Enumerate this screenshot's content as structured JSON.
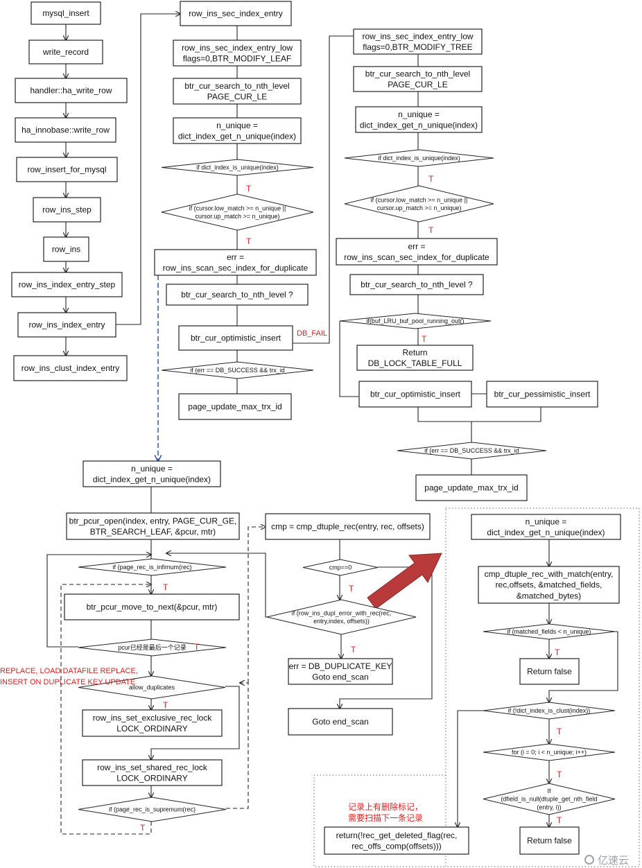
{
  "nodes": {
    "mysql_insert": [
      "mysql_insert"
    ],
    "write_record": [
      "write_record"
    ],
    "ha_write_row": [
      "handler::ha_write_row"
    ],
    "innobase_write_row": [
      "ha_innobase::write_row"
    ],
    "row_insert_for_mysql": [
      "row_insert_for_mysql"
    ],
    "row_ins_step": [
      "row_ins_step"
    ],
    "row_ins": [
      "row_ins"
    ],
    "row_ins_index_entry_step": [
      "row_ins_index_entry_step"
    ],
    "row_ins_index_entry": [
      "row_ins_index_entry"
    ],
    "row_ins_clust_index_entry": [
      "row_ins_clust_index_entry"
    ],
    "sec_index_entry": [
      "row_ins_sec_index_entry"
    ],
    "sec_low_leaf": [
      "row_ins_sec_index_entry_low",
      "flags=0,BTR_MODIFY_LEAF"
    ],
    "search_le_1": [
      "btr_cur_search_to_nth_level",
      "PAGE_CUR_LE"
    ],
    "n_unique_1": [
      "n_unique =",
      "dict_index_get_n_unique(index)"
    ],
    "is_unique_1": [
      "if dict_index_is_unique(index)"
    ],
    "cursor_match_1": [
      "if (cursor.low_match >= n_unique ||",
      "cursor.up_match >= n_unique)"
    ],
    "scan_dup_1": [
      "err =",
      "row_ins_scan_sec_index_for_duplicate"
    ],
    "search_q_1": [
      "btr_cur_search_to_nth_level ?"
    ],
    "opt_insert_1": [
      "btr_cur_optimistic_insert"
    ],
    "err_success_1": [
      "if (err == DB_SUCCESS && trx_id"
    ],
    "max_trx_1": [
      "page_update_max_trx_id"
    ],
    "sec_low_tree": [
      "row_ins_sec_index_entry_low",
      "flags=0,BTR_MODIFY_TREE"
    ],
    "search_le_2": [
      "btr_cur_search_to_nth_level",
      "PAGE_CUR_LE"
    ],
    "n_unique_2": [
      "n_unique =",
      "dict_index_get_n_unique(index)"
    ],
    "is_unique_2": [
      "if dict_index_is_unique(index)"
    ],
    "cursor_match_2": [
      "if (cursor.low_match >= n_unique ||",
      "cursor.up_match >= n_unique)"
    ],
    "scan_dup_2": [
      "err =",
      "row_ins_scan_sec_index_for_duplicate"
    ],
    "search_q_2": [
      "btr_cur_search_to_nth_level ?"
    ],
    "pool_running_out": [
      "if(buf_LRU_buf_pool_running_out()"
    ],
    "lock_table_full": [
      "Return",
      "DB_LOCK_TABLE_FULL"
    ],
    "opt_insert_2": [
      "btr_cur_optimistic_insert"
    ],
    "pess_insert": [
      "btr_cur_pessimistic_insert"
    ],
    "err_success_2": [
      "if (err == DB_SUCCESS && trx_id"
    ],
    "max_trx_2": [
      "page_update_max_trx_id"
    ],
    "n_unique_3": [
      "n_unique =",
      "dict_index_get_n_unique(index)"
    ],
    "pcur_open": [
      "btr_pcur_open(index, entry, PAGE_CUR_GE,",
      "BTR_SEARCH_LEAF, &pcur, mtr)"
    ],
    "is_infimum": [
      "if (page_rec_is_infimum(rec)"
    ],
    "move_to_next": [
      "btr_pcur_move_to_next(&pcur, mtr)"
    ],
    "pcur_last": [
      "pcur已经是最后一个记录"
    ],
    "allow_duplicates": [
      "allow_duplicates"
    ],
    "exclusive_lock": [
      "row_ins_set_exclusive_rec_lock",
      "LOCK_ORDINARY"
    ],
    "shared_lock": [
      "row_ins_set_shared_rec_lock",
      "LOCK_ORDINARY"
    ],
    "is_supremum": [
      "if (page_rec_is_supremum(rec)"
    ],
    "cmp_dtuple": [
      "cmp = cmp_dtuple_rec(entry, rec, offsets)"
    ],
    "cmp_zero": [
      "cmp==0"
    ],
    "dupl_error": [
      "if (row_ins_dupl_error_with_rec(rec,",
      "entry,index, offsets))"
    ],
    "dup_key": [
      "err = DB_DUPLICATE_KEY",
      "Goto end_scan"
    ],
    "goto_end": [
      "Goto end_scan"
    ],
    "n_unique_4": [
      "n_unique =",
      "dict_index_get_n_unique(index)"
    ],
    "with_match": [
      "cmp_dtuple_rec_with_match(entry,",
      "rec,offsets, &matched_fields,",
      "&matched_bytes)"
    ],
    "matched_lt": [
      "if (matched_fields < n_unique)"
    ],
    "return_false_1": [
      "Return false"
    ],
    "not_clust": [
      "if (!dict_index_is_clust(index))"
    ],
    "for_loop": [
      "for (i = 0; i < n_unique; i++)"
    ],
    "dfield_null": [
      "If",
      "(dfield_is_null(dtuple_get_nth_field",
      "(entry, i))"
    ],
    "return_false_2": [
      "Return false"
    ],
    "return_deleted": [
      "return(!rec_get_deleted_flag(rec,",
      "rec_offs_comp(offsets)))"
    ]
  },
  "labels": {
    "true_mark": "T",
    "db_fail": "DB_FAIL",
    "replace_note": [
      "REPLACE, LOAD DATAFILE REPLACE,",
      "INSERT ON DUPLICATE KEY UPDATE"
    ],
    "deleted_note": [
      "记录上有删除标记，",
      "需要扫描下一条记录"
    ]
  },
  "watermark": "亿速云",
  "colors": {
    "annotation": "#e02020",
    "dashed_arrow": "#1f4e9a",
    "big_arrow": "#b83a3a"
  }
}
